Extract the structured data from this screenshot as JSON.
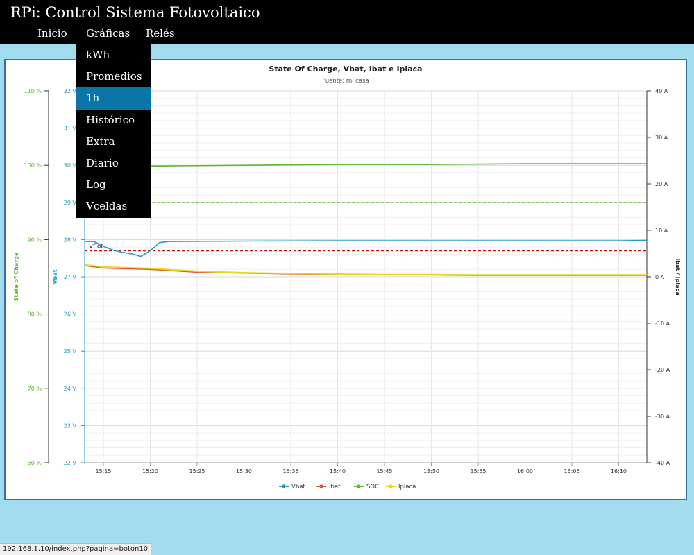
{
  "app": {
    "title": "RPi: Control Sistema Fotovoltaico"
  },
  "nav": {
    "items": [
      {
        "label": "Inicio"
      },
      {
        "label": "Gráficas"
      },
      {
        "label": "Relés"
      }
    ]
  },
  "dropdown": {
    "items": [
      {
        "label": "kWh"
      },
      {
        "label": "Promedios"
      },
      {
        "label": "1h",
        "active": true
      },
      {
        "label": "Histórico"
      },
      {
        "label": "Extra"
      },
      {
        "label": "Diario"
      },
      {
        "label": "Log"
      },
      {
        "label": "Vceldas"
      }
    ]
  },
  "status_bar": {
    "url": "192.168.1.10/index.php?pagina=boton10"
  },
  "colors": {
    "vbat": "#2b98c1",
    "ibat": "#e2582b",
    "soc": "#5cb833",
    "iplaca": "#e8d81c",
    "vflot_line": "#cc1111",
    "soc_ref_line": "#5cb833"
  },
  "chart_data": {
    "type": "line",
    "title": "State Of Charge, Vbat, Ibat e Iplaca",
    "subtitle": "Fuente: mi casa",
    "x_ticks": [
      "15:15",
      "15:20",
      "15:25",
      "15:30",
      "15:35",
      "15:40",
      "15:45",
      "15:50",
      "15:55",
      "16:00",
      "16:05",
      "16:10"
    ],
    "x_range": [
      "15:13",
      "16:13"
    ],
    "y_axes": {
      "soc": {
        "label": "State of Charge",
        "range": [
          60,
          110
        ],
        "ticks": [
          "60 %",
          "70 %",
          "80 %",
          "90 %",
          "100 %",
          "110 %"
        ]
      },
      "vbat": {
        "label": "Vbat",
        "range": [
          22,
          32
        ],
        "ticks": [
          "22 V",
          "23 V",
          "24 V",
          "25 V",
          "26 V",
          "27 V",
          "28 V",
          "29 V",
          "30 V",
          "31 V",
          "32 V"
        ]
      },
      "current": {
        "label": "Ibat / Iplaca",
        "range": [
          -40,
          40
        ],
        "ticks": [
          "-40 A",
          "-30 A",
          "-20 A",
          "-10 A",
          "0 A",
          "10 A",
          "20 A",
          "30 A",
          "40 A"
        ]
      }
    },
    "plot_lines": [
      {
        "label": "Vflot",
        "axis": "vbat",
        "value": 27.7
      },
      {
        "label": "",
        "axis": "vbat",
        "value": 29.0
      }
    ],
    "series": [
      {
        "name": "Vbat",
        "axis": "vbat",
        "x": [
          "15:13",
          "15:14",
          "15:15",
          "15:16",
          "15:17",
          "15:18",
          "15:19",
          "15:20",
          "15:21",
          "15:22",
          "15:30",
          "15:40",
          "15:50",
          "16:00",
          "16:10",
          "16:13"
        ],
        "values": [
          27.95,
          27.95,
          27.82,
          27.72,
          27.66,
          27.62,
          27.55,
          27.7,
          27.92,
          27.95,
          27.96,
          27.97,
          27.97,
          27.97,
          27.97,
          27.98
        ]
      },
      {
        "name": "Ibat",
        "axis": "current",
        "x": [
          "15:13",
          "15:15",
          "15:20",
          "15:25",
          "15:30",
          "15:35",
          "15:40",
          "15:45",
          "15:50",
          "15:55",
          "16:00",
          "16:05",
          "16:10",
          "16:13"
        ],
        "values": [
          2.4,
          1.9,
          1.6,
          1.0,
          0.8,
          0.6,
          0.5,
          0.4,
          0.4,
          0.3,
          0.3,
          0.3,
          0.3,
          0.3
        ]
      },
      {
        "name": "SOC",
        "axis": "soc",
        "x": [
          "15:13",
          "15:20",
          "15:30",
          "15:40",
          "15:50",
          "16:00",
          "16:10",
          "16:13"
        ],
        "values": [
          99.9,
          99.9,
          100.0,
          100.1,
          100.1,
          100.2,
          100.2,
          100.2
        ]
      },
      {
        "name": "Iplaca",
        "axis": "current",
        "x": [
          "15:13",
          "15:15",
          "15:20",
          "15:25",
          "15:30",
          "15:35",
          "15:40",
          "15:45",
          "15:50",
          "15:55",
          "16:00",
          "16:05",
          "16:10",
          "16:13"
        ],
        "values": [
          2.6,
          2.1,
          1.8,
          1.2,
          0.9,
          0.7,
          0.6,
          0.5,
          0.5,
          0.4,
          0.4,
          0.4,
          0.4,
          0.4
        ]
      }
    ],
    "legend": {
      "position": "bottom-center",
      "entries": [
        "Vbat",
        "Ibat",
        "SOC",
        "Iplaca"
      ]
    },
    "grid": true
  }
}
